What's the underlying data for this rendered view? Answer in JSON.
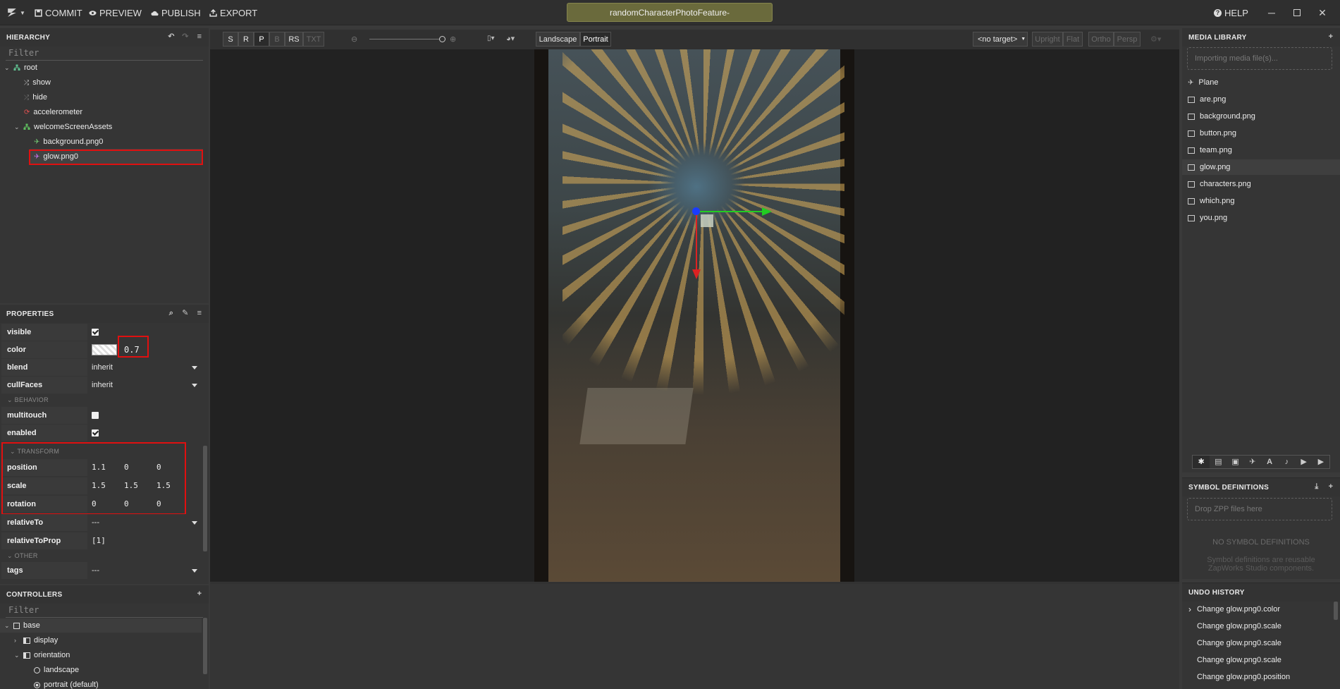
{
  "topbar": {
    "commit": "COMMIT",
    "preview": "PREVIEW",
    "publish": "PUBLISH",
    "export": "EXPORT",
    "project_title": "randomCharacterPhotoFeature-",
    "help": "HELP"
  },
  "hierarchy": {
    "title": "HIERARCHY",
    "filter_placeholder": "Filter",
    "items": [
      {
        "label": "root"
      },
      {
        "label": "show"
      },
      {
        "label": "hide"
      },
      {
        "label": "accelerometer"
      },
      {
        "label": "welcomeScreenAssets"
      },
      {
        "label": "background.png0"
      },
      {
        "label": "glow.png0"
      }
    ]
  },
  "properties": {
    "title": "PROPERTIES",
    "visible_label": "visible",
    "color_label": "color",
    "color_opacity": "0.7",
    "blend_label": "blend",
    "blend_value": "inherit",
    "cullfaces_label": "cullFaces",
    "cullfaces_value": "inherit",
    "behavior_section": "BEHAVIOR",
    "multitouch_label": "multitouch",
    "enabled_label": "enabled",
    "transform_section": "TRANSFORM",
    "position_label": "position",
    "position": [
      "1.1",
      "0",
      "0"
    ],
    "scale_label": "scale",
    "scale": [
      "1.5",
      "1.5",
      "1.5"
    ],
    "rotation_label": "rotation",
    "rotation": [
      "0",
      "0",
      "0"
    ],
    "relativeto_label": "relativeTo",
    "relativeto_value": "---",
    "relativetoprop_label": "relativeToProp",
    "relativetoprop_value": "[1]",
    "other_section": "OTHER",
    "tags_label": "tags",
    "tags_value": "---"
  },
  "controllers": {
    "title": "CONTROLLERS",
    "filter_placeholder": "Filter",
    "items": [
      {
        "label": "base"
      },
      {
        "label": "display"
      },
      {
        "label": "orientation"
      },
      {
        "label": "landscape"
      },
      {
        "label": "portrait (default)"
      }
    ]
  },
  "viewport_toolbar": {
    "modes": [
      "S",
      "R",
      "P",
      "B",
      "RS",
      "TXT"
    ],
    "landscape": "Landscape",
    "portrait": "Portrait",
    "target": "<no target>",
    "upright": "Upright",
    "flat": "Flat",
    "ortho": "Ortho",
    "persp": "Persp"
  },
  "media_library": {
    "title": "MEDIA LIBRARY",
    "import_placeholder": "Importing media file(s)...",
    "items": [
      {
        "label": "Plane",
        "icon": "plane-icon"
      },
      {
        "label": "are.png",
        "icon": "image-icon"
      },
      {
        "label": "background.png",
        "icon": "image-icon"
      },
      {
        "label": "button.png",
        "icon": "image-icon"
      },
      {
        "label": "team.png",
        "icon": "image-icon"
      },
      {
        "label": "glow.png",
        "icon": "image-icon"
      },
      {
        "label": "characters.png",
        "icon": "image-icon"
      },
      {
        "label": "which.png",
        "icon": "image-icon"
      },
      {
        "label": "you.png",
        "icon": "image-icon"
      }
    ]
  },
  "symbol_definitions": {
    "title": "SYMBOL DEFINITIONS",
    "drop_placeholder": "Drop ZPP files here",
    "empty_title": "NO SYMBOL DEFINITIONS",
    "empty_desc_1": "Symbol definitions are reusable",
    "empty_desc_2": "ZapWorks Studio components."
  },
  "undo_history": {
    "title": "UNDO HISTORY",
    "items": [
      {
        "label": "Change glow.png0.color"
      },
      {
        "label": "Change glow.png0.scale"
      },
      {
        "label": "Change glow.png0.scale"
      },
      {
        "label": "Change glow.png0.scale"
      },
      {
        "label": "Change glow.png0.position"
      }
    ]
  },
  "colors": {
    "selection_red": "#e01010",
    "title_olive": "#6a6a3c",
    "gizmo_green": "#22cc22",
    "gizmo_red": "#dd2222",
    "gizmo_blue": "#1a3cff"
  }
}
